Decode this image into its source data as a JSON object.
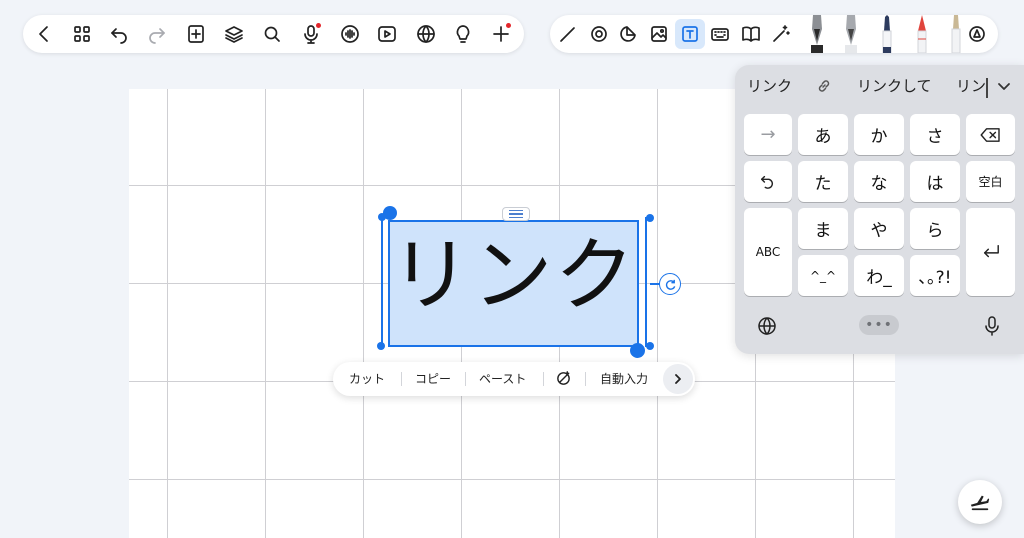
{
  "colors": {
    "accent": "#1a73e8",
    "selection_fill": "#cfe3fb",
    "notification_dot": "#e3262b",
    "canvas_bg": "#ffffff",
    "grid_line": "#cfcfd3",
    "app_bg": "#f1f4f9"
  },
  "toolbar_left": {
    "icons": [
      "back-icon",
      "grid-icon",
      "undo-icon",
      "redo-icon",
      "add-page-icon",
      "layers-icon",
      "search-icon",
      "microphone-icon",
      "audio-wave-icon",
      "play-icon",
      "globe-icon",
      "lightbulb-icon",
      "add-icon"
    ]
  },
  "toolbar_right": {
    "icons": [
      "pen-icon",
      "lasso-icon",
      "sticker-icon",
      "image-icon",
      "text-box-icon",
      "keyboard-icon",
      "book-icon",
      "magic-pen-icon",
      "fountain-pen-icon",
      "calligraphy-pen-icon",
      "ballpoint-pen-icon",
      "pencil-icon",
      "brush-icon",
      "color-picker-icon"
    ],
    "active_tool": "text-box-icon"
  },
  "text_box": {
    "content": "リンク"
  },
  "context_menu": {
    "cut": "カット",
    "copy": "コピー",
    "paste": "ペースト",
    "autofill": "自動入力"
  },
  "keyboard": {
    "candidates": [
      "リンク",
      "リンクして",
      "リン"
    ],
    "candidate_link_icon": "link-icon",
    "keys": {
      "next": "→",
      "a": "あ",
      "ka": "か",
      "sa": "さ",
      "ta": "た",
      "na": "な",
      "ha": "は",
      "space": "空白",
      "abc": "ABC",
      "ma": "ま",
      "ya": "や",
      "ra": "ら",
      "kaomoji": "^_^",
      "wa": "わ_",
      "punct": "､｡?!"
    },
    "dots": "•••"
  }
}
